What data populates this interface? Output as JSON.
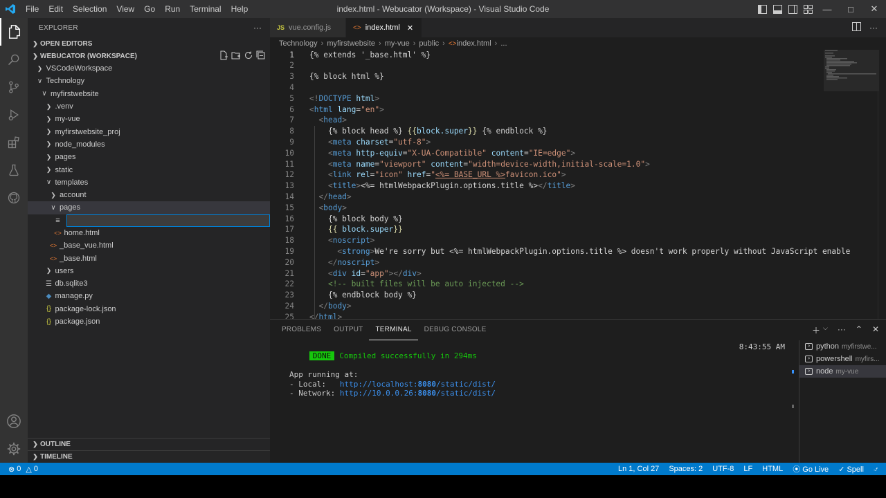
{
  "window": {
    "title": "index.html - Webucator (Workspace) - Visual Studio Code",
    "menu": [
      "File",
      "Edit",
      "Selection",
      "View",
      "Go",
      "Run",
      "Terminal",
      "Help"
    ]
  },
  "sidebar": {
    "header": "EXPLORER",
    "open_editors": "OPEN EDITORS",
    "workspace": "WEBUCATOR (WORKSPACE)",
    "tree": [
      {
        "label": "VSCodeWorkspace",
        "indent": 1,
        "type": "folder-closed"
      },
      {
        "label": "Technology",
        "indent": 1,
        "type": "folder-open"
      },
      {
        "label": "myfirstwebsite",
        "indent": 2,
        "type": "folder-open"
      },
      {
        "label": ".venv",
        "indent": 3,
        "type": "folder-closed"
      },
      {
        "label": "my-vue",
        "indent": 3,
        "type": "folder-closed"
      },
      {
        "label": "myfirstwebsite_proj",
        "indent": 3,
        "type": "folder-closed"
      },
      {
        "label": "node_modules",
        "indent": 3,
        "type": "folder-closed"
      },
      {
        "label": "pages",
        "indent": 3,
        "type": "folder-closed"
      },
      {
        "label": "static",
        "indent": 3,
        "type": "folder-closed"
      },
      {
        "label": "templates",
        "indent": 3,
        "type": "folder-open"
      },
      {
        "label": "account",
        "indent": 4,
        "type": "folder-closed"
      },
      {
        "label": "pages",
        "indent": 4,
        "type": "folder-open",
        "selected": true
      },
      {
        "label": "",
        "indent": 5,
        "type": "rename"
      },
      {
        "label": "home.html",
        "indent": 5,
        "type": "html"
      },
      {
        "label": "_base_vue.html",
        "indent": 4,
        "type": "html"
      },
      {
        "label": "_base.html",
        "indent": 4,
        "type": "html"
      },
      {
        "label": "users",
        "indent": 3,
        "type": "folder-closed"
      },
      {
        "label": "db.sqlite3",
        "indent": 3,
        "type": "db"
      },
      {
        "label": "manage.py",
        "indent": 3,
        "type": "py"
      },
      {
        "label": "package-lock.json",
        "indent": 3,
        "type": "json"
      },
      {
        "label": "package.json",
        "indent": 3,
        "type": "json"
      }
    ],
    "outline": "OUTLINE",
    "timeline": "TIMELINE"
  },
  "editor": {
    "tabs": [
      {
        "label": "vue.config.js",
        "icon": "JS",
        "active": false
      },
      {
        "label": "index.html",
        "icon": "<>",
        "active": true
      }
    ],
    "breadcrumb": [
      "Technology",
      "myfirstwebsite",
      "my-vue",
      "public",
      "index.html",
      "..."
    ],
    "lines": [
      {
        "n": "1",
        "html": "{% extends '_base.html' %}"
      },
      {
        "n": "2",
        "html": ""
      },
      {
        "n": "3",
        "html": "{% block html %}"
      },
      {
        "n": "4",
        "html": ""
      },
      {
        "n": "5",
        "html": "<span class=\"c-punc\">&lt;!</span><span class=\"c-tag\">DOCTYPE</span> <span class=\"c-attr\">html</span><span class=\"c-punc\">&gt;</span>"
      },
      {
        "n": "6",
        "html": "<span class=\"c-punc\">&lt;</span><span class=\"c-tag\">html</span> <span class=\"c-attr\">lang</span>=<span class=\"c-str\">\"en\"</span><span class=\"c-punc\">&gt;</span>"
      },
      {
        "n": "7",
        "html": "  <span class=\"c-punc\">&lt;</span><span class=\"c-tag\">head</span><span class=\"c-punc\">&gt;</span>"
      },
      {
        "n": "8",
        "html": "    {% block head %} <span class=\"c-yel\">{{</span><span class=\"c-attr\">block.super</span><span class=\"c-yel\">}}</span> {% endblock %}"
      },
      {
        "n": "9",
        "html": "    <span class=\"c-punc\">&lt;</span><span class=\"c-tag\">meta</span> <span class=\"c-attr\">charset</span>=<span class=\"c-str\">\"utf-8\"</span><span class=\"c-punc\">&gt;</span>"
      },
      {
        "n": "10",
        "html": "    <span class=\"c-punc\">&lt;</span><span class=\"c-tag\">meta</span> <span class=\"c-attr\">http-equiv</span>=<span class=\"c-str\">\"X-UA-Compatible\"</span> <span class=\"c-attr\">content</span>=<span class=\"c-str\">\"IE=edge\"</span><span class=\"c-punc\">&gt;</span>"
      },
      {
        "n": "11",
        "html": "    <span class=\"c-punc\">&lt;</span><span class=\"c-tag\">meta</span> <span class=\"c-attr\">name</span>=<span class=\"c-str\">\"viewport\"</span> <span class=\"c-attr\">content</span>=<span class=\"c-str\">\"width=device-width,initial-scale=1.0\"</span><span class=\"c-punc\">&gt;</span>"
      },
      {
        "n": "12",
        "html": "    <span class=\"c-punc\">&lt;</span><span class=\"c-tag\">link</span> <span class=\"c-attr\">rel</span>=<span class=\"c-str\">\"icon\"</span> <span class=\"c-attr\">href</span>=<span class=\"c-str\">\"<u>&lt;%= BASE_URL %&gt;</u>favicon.ico\"</span><span class=\"c-punc\">&gt;</span>"
      },
      {
        "n": "13",
        "html": "    <span class=\"c-punc\">&lt;</span><span class=\"c-tag\">title</span><span class=\"c-punc\">&gt;</span>&lt;%= htmlWebpackPlugin.options.title %&gt;<span class=\"c-punc\">&lt;/</span><span class=\"c-tag\">title</span><span class=\"c-punc\">&gt;</span>"
      },
      {
        "n": "14",
        "html": "  <span class=\"c-punc\">&lt;/</span><span class=\"c-tag\">head</span><span class=\"c-punc\">&gt;</span>"
      },
      {
        "n": "15",
        "html": "  <span class=\"c-punc\">&lt;</span><span class=\"c-tag\">body</span><span class=\"c-punc\">&gt;</span>"
      },
      {
        "n": "16",
        "html": "    {% block body %}"
      },
      {
        "n": "17",
        "html": "    <span class=\"c-yel\">{{</span> <span class=\"c-attr\">block.super</span><span class=\"c-yel\">}}</span>"
      },
      {
        "n": "18",
        "html": "    <span class=\"c-punc\">&lt;</span><span class=\"c-tag\">noscript</span><span class=\"c-punc\">&gt;</span>"
      },
      {
        "n": "19",
        "html": "      <span class=\"c-punc\">&lt;</span><span class=\"c-tag\">strong</span><span class=\"c-punc\">&gt;</span>We're sorry but &lt;%= htmlWebpackPlugin.options.title %&gt; doesn't work properly without JavaScript enable"
      },
      {
        "n": "20",
        "html": "    <span class=\"c-punc\">&lt;/</span><span class=\"c-tag\">noscript</span><span class=\"c-punc\">&gt;</span>"
      },
      {
        "n": "21",
        "html": "    <span class=\"c-punc\">&lt;</span><span class=\"c-tag\">div</span> <span class=\"c-attr\">id</span>=<span class=\"c-str\">\"app\"</span><span class=\"c-punc\">&gt;&lt;/</span><span class=\"c-tag\">div</span><span class=\"c-punc\">&gt;</span>"
      },
      {
        "n": "22",
        "html": "    <span class=\"c-com\">&lt;!-- built files will be auto injected --&gt;</span>"
      },
      {
        "n": "23",
        "html": "    {% endblock body %}"
      },
      {
        "n": "24",
        "html": "  <span class=\"c-punc\">&lt;/</span><span class=\"c-tag\">body</span><span class=\"c-punc\">&gt;</span>"
      },
      {
        "n": "25",
        "html": "<span class=\"c-punc\">&lt;/</span><span class=\"c-tag\">html</span><span class=\"c-punc\">&gt;</span>"
      }
    ]
  },
  "panel": {
    "tabs": [
      "PROBLEMS",
      "OUTPUT",
      "TERMINAL",
      "DEBUG CONSOLE"
    ],
    "active_tab": "TERMINAL",
    "terminal": {
      "done_badge": "DONE",
      "compiled": "Compiled successfully in 294ms",
      "time": "8:43:55 AM",
      "app_running": "App running at:",
      "local_label": "- Local:   ",
      "local_url_a": "http://localhost:",
      "local_port": "8080",
      "local_url_b": "/static/dist/",
      "network_label": "- Network: ",
      "network_url_a": "http://10.0.0.26:",
      "network_port": "8080",
      "network_url_b": "/static/dist/"
    },
    "terminals": [
      {
        "name": "python",
        "sub": "myfirstwe..."
      },
      {
        "name": "powershell",
        "sub": "myfirs..."
      },
      {
        "name": "node",
        "sub": "my-vue",
        "active": true
      }
    ]
  },
  "status": {
    "errors": "0",
    "warnings": "0",
    "position": "Ln 1, Col 27",
    "spaces": "Spaces: 2",
    "encoding": "UTF-8",
    "eol": "LF",
    "language": "HTML",
    "golive": "Go Live",
    "spell": "Spell"
  },
  "colors": {
    "accent": "#007acc",
    "activity": "#333333",
    "sidebar": "#252526",
    "editor": "#1e1e1e"
  }
}
